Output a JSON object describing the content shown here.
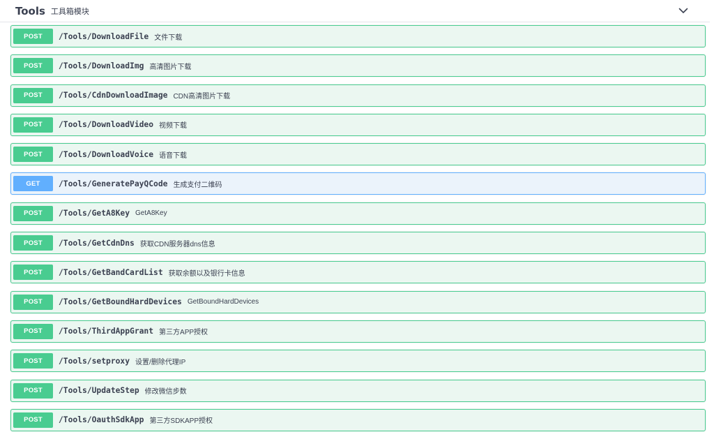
{
  "tag": {
    "name": "Tools",
    "description": "工具箱模块",
    "toggle_icon": "chevron-down-icon"
  },
  "colors": {
    "post_border": "#49cc90",
    "post_bg": "#ebf7f1",
    "get_border": "#61affe",
    "get_bg": "#ebf3fb"
  },
  "operations": [
    {
      "method": "POST",
      "path": "/Tools/DownloadFile",
      "summary": "文件下载"
    },
    {
      "method": "POST",
      "path": "/Tools/DownloadImg",
      "summary": "高清图片下载"
    },
    {
      "method": "POST",
      "path": "/Tools/CdnDownloadImage",
      "summary": "CDN高清图片下载"
    },
    {
      "method": "POST",
      "path": "/Tools/DownloadVideo",
      "summary": "视频下载"
    },
    {
      "method": "POST",
      "path": "/Tools/DownloadVoice",
      "summary": "语音下载"
    },
    {
      "method": "GET",
      "path": "/Tools/GeneratePayQCode",
      "summary": "生成支付二维码"
    },
    {
      "method": "POST",
      "path": "/Tools/GetA8Key",
      "summary": "GetA8Key"
    },
    {
      "method": "POST",
      "path": "/Tools/GetCdnDns",
      "summary": "获取CDN服务器dns信息"
    },
    {
      "method": "POST",
      "path": "/Tools/GetBandCardList",
      "summary": "获取余额以及银行卡信息"
    },
    {
      "method": "POST",
      "path": "/Tools/GetBoundHardDevices",
      "summary": "GetBoundHardDevices"
    },
    {
      "method": "POST",
      "path": "/Tools/ThirdAppGrant",
      "summary": "第三方APP授权"
    },
    {
      "method": "POST",
      "path": "/Tools/setproxy",
      "summary": "设置/删除代理IP"
    },
    {
      "method": "POST",
      "path": "/Tools/UpdateStep",
      "summary": "修改微信步数"
    },
    {
      "method": "POST",
      "path": "/Tools/OauthSdkApp",
      "summary": "第三方SDKAPP授权"
    }
  ]
}
